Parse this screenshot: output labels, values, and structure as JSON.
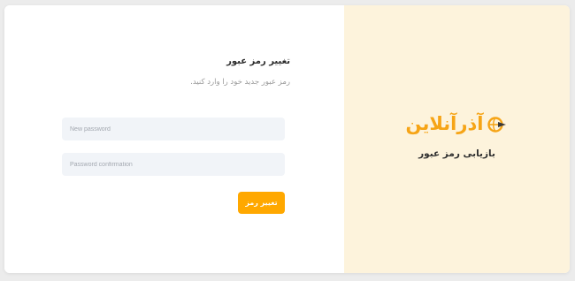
{
  "form": {
    "title": "تغییر رمز عبور",
    "subtitle": "رمز عبور جدید خود را وارد کنید.",
    "new_password_placeholder": "New password",
    "confirm_password_placeholder": "Password confirmation",
    "submit_label": "تغییر رمز"
  },
  "brand": {
    "logo_text": "آذرآنلاین",
    "caption": "بازیابی رمز عبور",
    "logo_icon": "globe-arrow-icon"
  },
  "colors": {
    "accent": "#ffa800",
    "brand_panel": "#fdf3dc",
    "input_bg": "#f1f4f8"
  }
}
